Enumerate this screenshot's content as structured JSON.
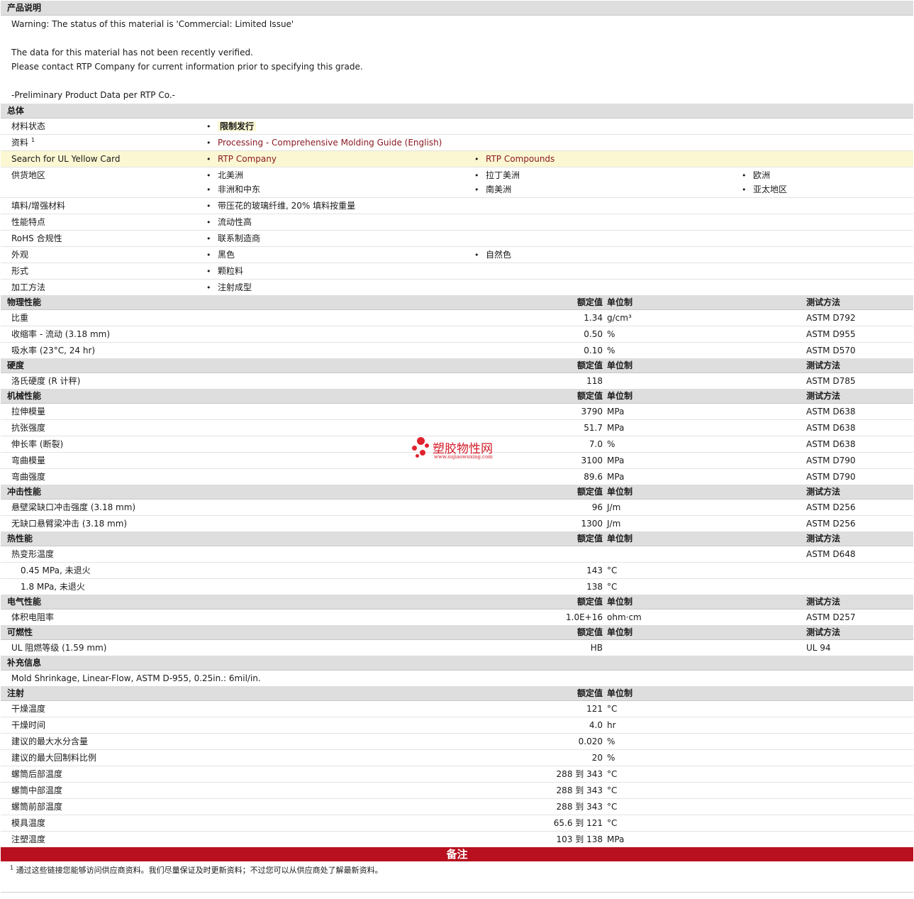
{
  "product_notes": {
    "header": "产品说明",
    "lines": [
      "Warning: The status of this material is 'Commercial: Limited Issue'",
      "",
      "The data for this material has not been recently verified.",
      "Please contact RTP Company for current information prior to specifying this grade.",
      "",
      "-Preliminary Product Data per RTP Co.-"
    ]
  },
  "general": {
    "header": "总体",
    "status_label": "材料状态",
    "status_value": "限制发行",
    "doc_label": "资料",
    "doc_sup": "1",
    "doc_link": "Processing - Comprehensive Molding Guide (English)",
    "ul_label": "Search for UL Yellow Card",
    "ul_links": [
      "RTP Company",
      "RTP Compounds"
    ],
    "region_label": "供货地区",
    "regions": [
      "北美洲",
      "拉丁美洲",
      "欧洲",
      "非洲和中东",
      "南美洲",
      "亚太地区"
    ],
    "filler_label": "填料/增强材料",
    "filler_value": "带压花的玻璃纤维, 20% 填料按重量",
    "features_label": "性能特点",
    "features_value": "流动性高",
    "rohs_label": "RoHS 合规性",
    "rohs_value": "联系制造商",
    "appearance_label": "外观",
    "appearance_values": [
      "黑色",
      "自然色"
    ],
    "form_label": "形式",
    "form_value": "颗粒料",
    "processing_label": "加工方法",
    "processing_value": "注射成型"
  },
  "headers": {
    "value": "额定值",
    "unit": "单位制",
    "test": "测试方法"
  },
  "sections": {
    "physical": {
      "title": "物理性能",
      "rows": [
        {
          "label": "比重",
          "value": "1.34",
          "unit": "g/cm³",
          "test": "ASTM D792"
        },
        {
          "label": "收缩率  - 流动  (3.18 mm)",
          "value": "0.50",
          "unit": "%",
          "test": "ASTM D955"
        },
        {
          "label": "吸水率  (23°C, 24 hr)",
          "value": "0.10",
          "unit": "%",
          "test": "ASTM D570"
        }
      ]
    },
    "hardness": {
      "title": "硬度",
      "rows": [
        {
          "label": "洛氏硬度  (R 计秤)",
          "value": "118",
          "unit": "",
          "test": "ASTM D785"
        }
      ]
    },
    "mechanical": {
      "title": "机械性能",
      "rows": [
        {
          "label": "拉伸模量",
          "value": "3790",
          "unit": "MPa",
          "test": "ASTM D638"
        },
        {
          "label": "抗张强度",
          "value": "51.7",
          "unit": "MPa",
          "test": "ASTM D638"
        },
        {
          "label": "伸长率  (断裂)",
          "value": "7.0",
          "unit": "%",
          "test": "ASTM D638"
        },
        {
          "label": "弯曲模量",
          "value": "3100",
          "unit": "MPa",
          "test": "ASTM D790"
        },
        {
          "label": "弯曲强度",
          "value": "89.6",
          "unit": "MPa",
          "test": "ASTM D790"
        }
      ]
    },
    "impact": {
      "title": "冲击性能",
      "rows": [
        {
          "label": "悬壁梁缺口冲击强度  (3.18 mm)",
          "value": "96",
          "unit": "J/m",
          "test": "ASTM D256"
        },
        {
          "label": "无缺口悬臂梁冲击  (3.18 mm)",
          "value": "1300",
          "unit": "J/m",
          "test": "ASTM D256"
        }
      ]
    },
    "thermal": {
      "title": "热性能",
      "hdt_label": "热变形温度",
      "hdt_test": "ASTM D648",
      "rows": [
        {
          "label": "0.45 MPa, 未退火",
          "value": "143",
          "unit": "°C"
        },
        {
          "label": "1.8 MPa, 未退火",
          "value": "138",
          "unit": "°C"
        }
      ]
    },
    "electrical": {
      "title": "电气性能",
      "rows": [
        {
          "label": "体积电阻率",
          "value": "1.0E+16",
          "unit": "ohm·cm",
          "test": "ASTM D257"
        }
      ]
    },
    "flammability": {
      "title": "可燃性",
      "rows": [
        {
          "label": "UL 阻燃等级  (1.59 mm)",
          "value": "HB",
          "unit": "",
          "test": "UL 94"
        }
      ]
    },
    "supplemental": {
      "title": "补充信息",
      "text": "Mold Shrinkage, Linear-Flow, ASTM D-955, 0.25in.: 6mil/in."
    },
    "injection": {
      "title": "注射",
      "rows": [
        {
          "label": "干燥温度",
          "value": "121",
          "unit": "°C"
        },
        {
          "label": "干燥时间",
          "value": "4.0",
          "unit": "hr"
        },
        {
          "label": "建议的最大水分含量",
          "value": "0.020",
          "unit": "%"
        },
        {
          "label": "建议的最大回制料比例",
          "value": "20",
          "unit": "%"
        },
        {
          "label": "螺筒后部温度",
          "value": "288 到  343",
          "unit": "°C"
        },
        {
          "label": "螺筒中部温度",
          "value": "288 到  343",
          "unit": "°C"
        },
        {
          "label": "螺筒前部温度",
          "value": "288 到  343",
          "unit": "°C"
        },
        {
          "label": "模具温度",
          "value": "65.6 到  121",
          "unit": "°C"
        },
        {
          "label": "注塑温度",
          "value": "103 到  138",
          "unit": "MPa"
        }
      ]
    }
  },
  "remarks": {
    "title": "备注",
    "footnote_sup": "1",
    "footnote": "通过这些链接您能够访问供应商资料。我们尽量保证及时更新资料；不过您可以从供应商处了解最新资料。"
  },
  "watermark": {
    "name": "塑胶物性网",
    "url": "www.sujiaowuxing.com",
    "color": "#e0212e"
  },
  "colors": {
    "section_bg": "#dedede",
    "highlight_row": "#fbf7d3",
    "link": "#8a1a22",
    "remarks_bar": "#b8101e"
  }
}
